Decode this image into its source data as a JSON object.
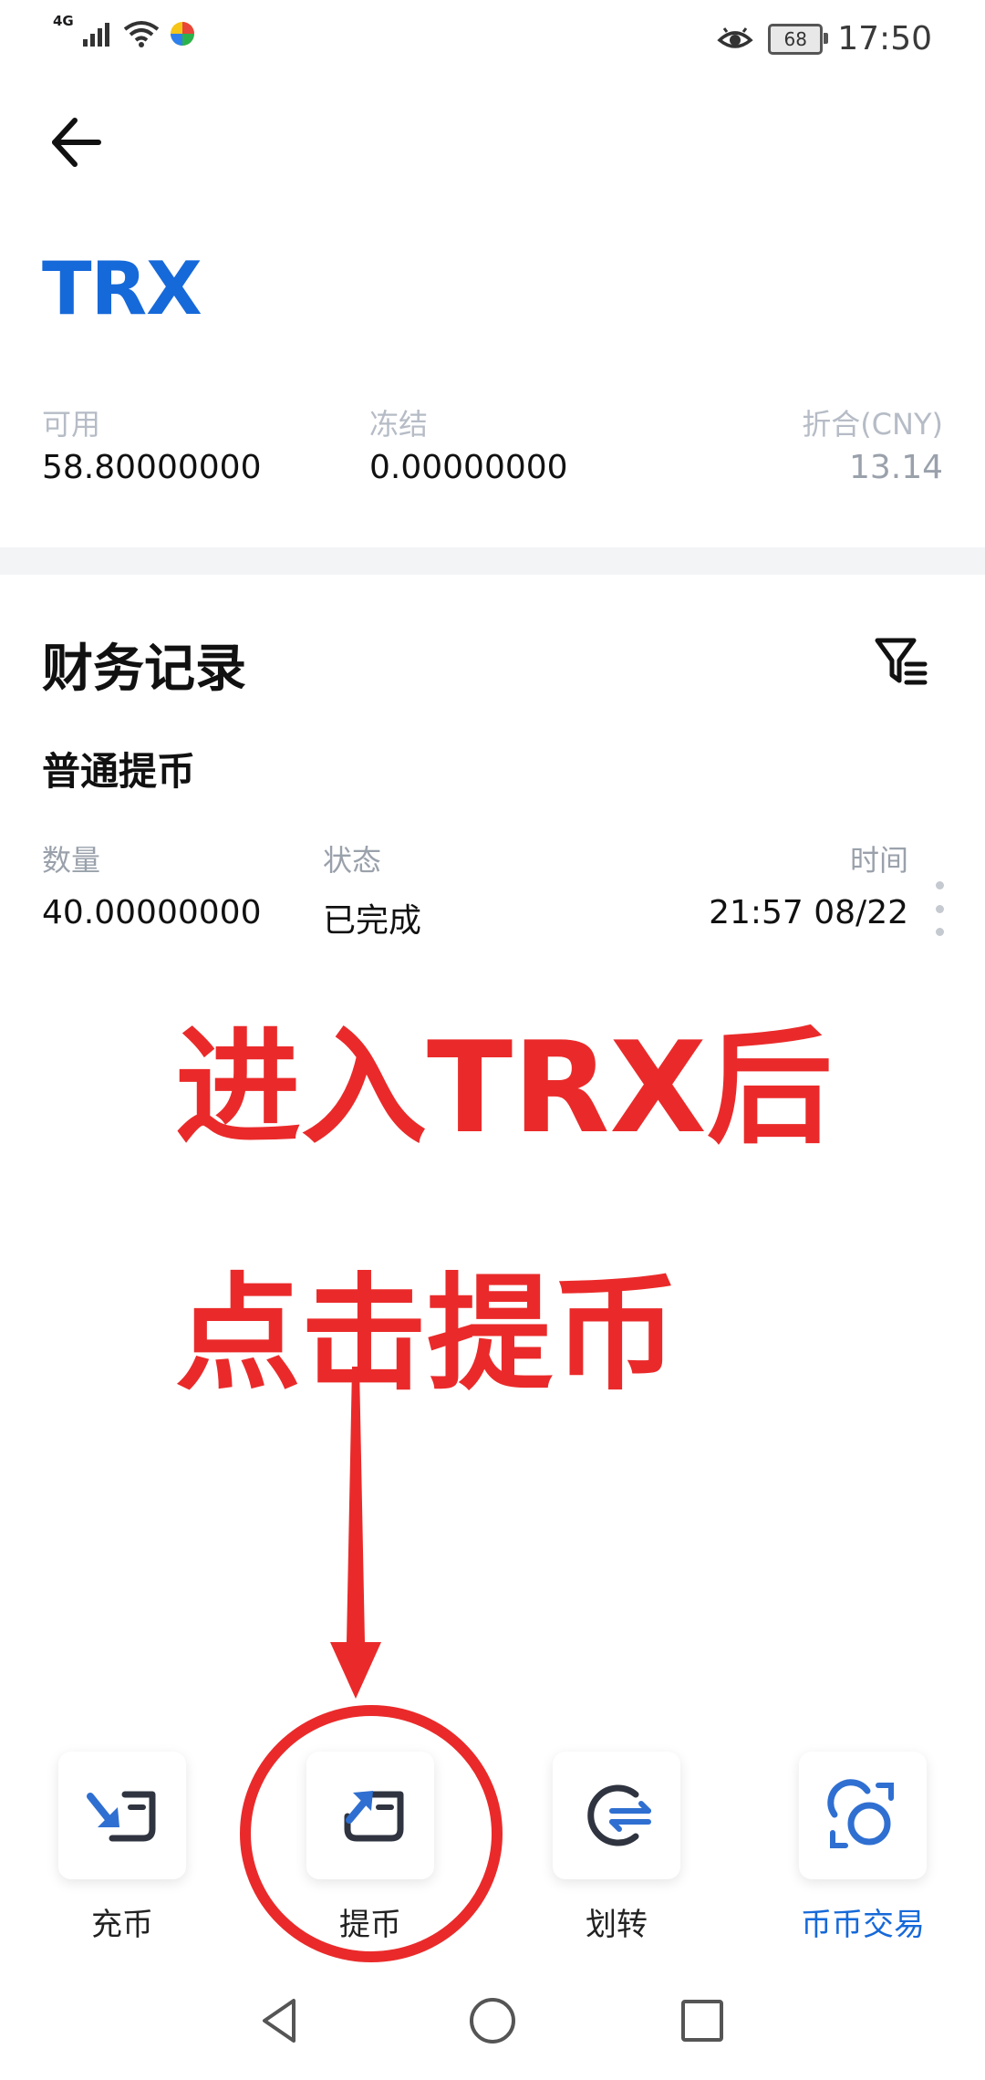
{
  "status_bar": {
    "network": "4G",
    "battery": "68",
    "time": "17:50"
  },
  "header": {
    "coin": "TRX"
  },
  "balances": [
    {
      "label": "可用",
      "value": "58.80000000"
    },
    {
      "label": "冻结",
      "value": "0.00000000"
    },
    {
      "label": "折合(CNY)",
      "value": "13.14"
    }
  ],
  "records": {
    "title": "财务记录",
    "subtitle": "普通提币",
    "columns": [
      "数量",
      "状态",
      "时间"
    ],
    "rows": [
      {
        "amount": "40.00000000",
        "status": "已完成",
        "time": "21:57 08/22"
      }
    ]
  },
  "annotations": {
    "line1": "进入TRX后",
    "line2": "点击提币"
  },
  "actions": [
    {
      "label": "充币",
      "icon": "deposit-icon"
    },
    {
      "label": "提币",
      "icon": "withdraw-icon"
    },
    {
      "label": "划转",
      "icon": "transfer-icon"
    },
    {
      "label": "币币交易",
      "icon": "trade-icon"
    }
  ],
  "colors": {
    "brand_blue": "#1669d9",
    "annotation_red": "#ea2a2a"
  }
}
